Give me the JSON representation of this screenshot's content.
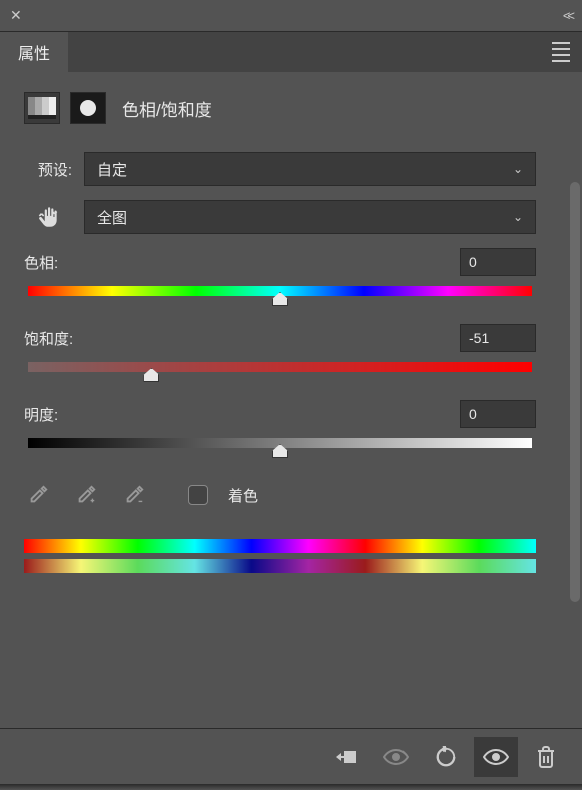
{
  "panel": {
    "tab": "属性",
    "title": "色相/饱和度"
  },
  "preset": {
    "label": "预设:",
    "value": "自定"
  },
  "channel": {
    "value": "全图"
  },
  "sliders": {
    "hue": {
      "label": "色相:",
      "value": "0",
      "position": 50
    },
    "saturation": {
      "label": "饱和度:",
      "value": "-51",
      "position": 24.5
    },
    "lightness": {
      "label": "明度:",
      "value": "0",
      "position": 50
    }
  },
  "colorize": {
    "label": "着色",
    "checked": false
  }
}
